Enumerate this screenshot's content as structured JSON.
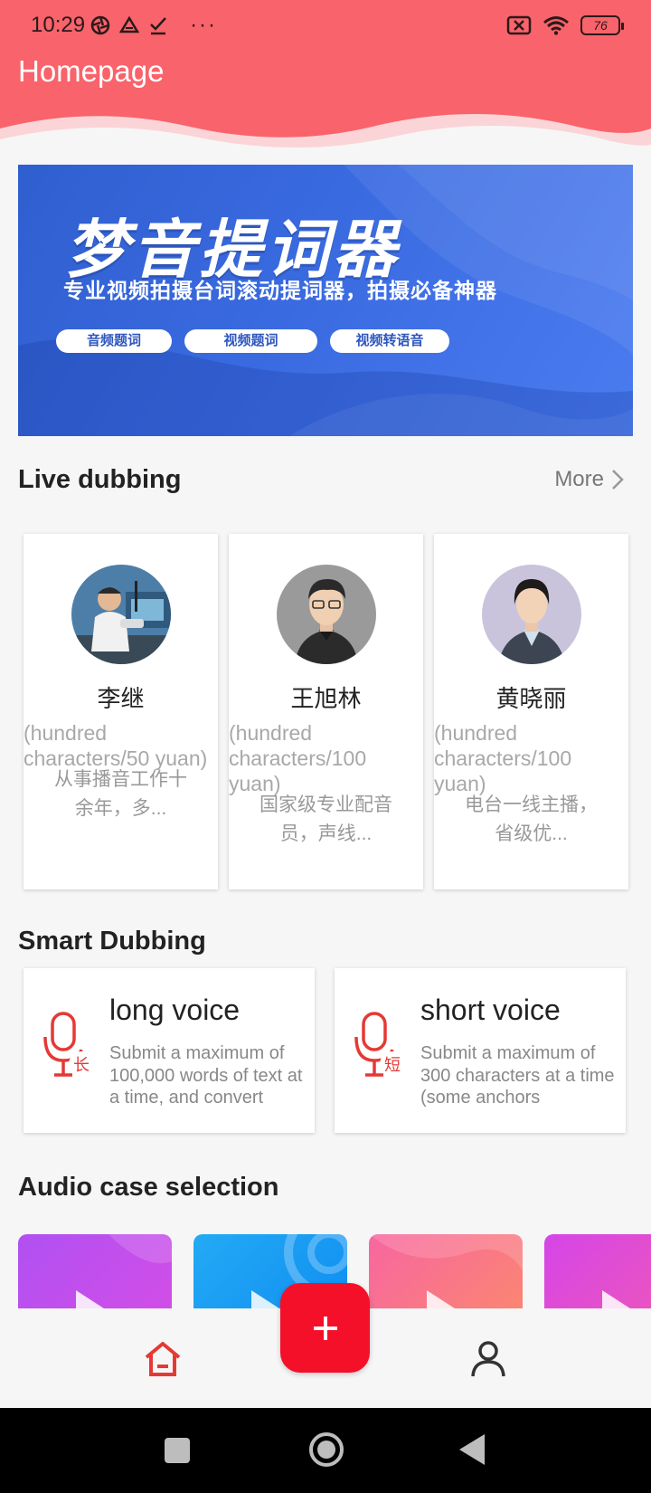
{
  "status_bar": {
    "time": "10:29",
    "dots": "···",
    "battery": "76"
  },
  "header": {
    "title": "Homepage"
  },
  "banner": {
    "title": "梦音提词器",
    "subtitle": "专业视频拍摄台词滚动提词器，拍摄必备神器",
    "pills": [
      "音频题词",
      "视频题词",
      "视频转语音"
    ]
  },
  "live_dubbing": {
    "title": "Live dubbing",
    "more_label": "More",
    "anchors": [
      {
        "name": "李继",
        "price": "(hundred characters/50 yuan)",
        "desc": "从事播音工作十余年，多..."
      },
      {
        "name": "王旭林",
        "price": "(hundred characters/100 yuan)",
        "desc": "国家级专业配音员，声线..."
      },
      {
        "name": "黄晓丽",
        "price": "(hundred characters/100 yuan)",
        "desc": "电台一线主播，省级优..."
      }
    ]
  },
  "smart_dubbing": {
    "title": "Smart Dubbing",
    "cards": [
      {
        "name": "long voice",
        "badge": "长",
        "desc": "Submit a maximum of 100,000 words of text at a time, and convert"
      },
      {
        "name": "short voice",
        "badge": "短",
        "desc": "Submit a maximum of 300 characters at a time (some anchors"
      }
    ]
  },
  "audio_cases": {
    "title": "Audio case selection"
  },
  "bottom_nav": {
    "home_icon": "home-icon",
    "add_icon": "plus-icon",
    "profile_icon": "user-icon"
  },
  "colors": {
    "header": "#f9636b",
    "accent": "#e53935",
    "fab": "#f5102a",
    "banner": "#3a6ae0"
  }
}
